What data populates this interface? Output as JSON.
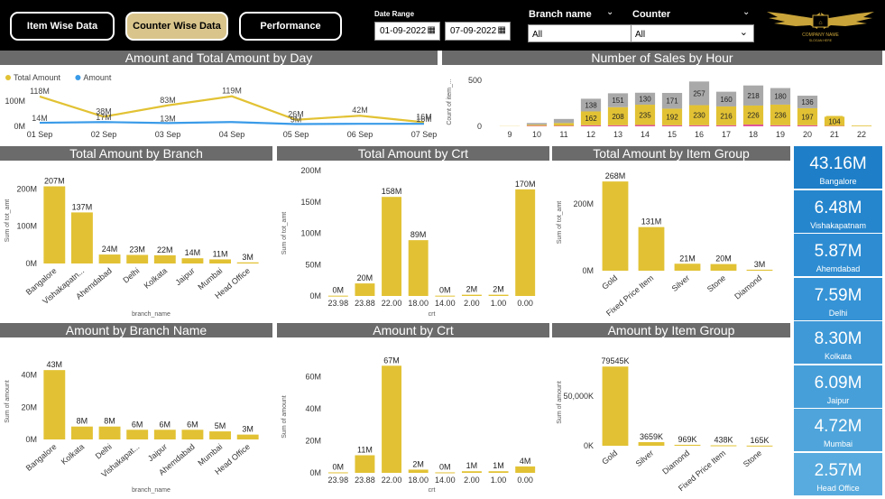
{
  "nav": {
    "item_wise": "Item Wise Data",
    "counter_wise": "Counter Wise Data",
    "performance": "Performance"
  },
  "filters": {
    "date_range_label": "Date Range",
    "date_from": "01-09-2022",
    "date_to": "07-09-2022",
    "branch_label": "Branch name",
    "branch_value": "All",
    "counter_label": "Counter",
    "counter_value": "All"
  },
  "logo": {
    "text": "COMPANY NAME",
    "tagline": "SLOGAN HERE"
  },
  "accent": "#e2c234",
  "cards": [
    {
      "value": "43.16M",
      "name": "Bangalore",
      "color": "#1e7fc8"
    },
    {
      "value": "6.48M",
      "name": "Vishakapatnam",
      "color": "#2686cd"
    },
    {
      "value": "5.87M",
      "name": "Ahemdabad",
      "color": "#2e8dd2"
    },
    {
      "value": "7.59M",
      "name": "Delhi",
      "color": "#3693d5"
    },
    {
      "value": "8.30M",
      "name": "Kolkata",
      "color": "#3f99d7"
    },
    {
      "value": "6.09M",
      "name": "Jaipur",
      "color": "#479fd9"
    },
    {
      "value": "4.72M",
      "name": "Mumbai",
      "color": "#4fa5db"
    },
    {
      "value": "2.57M",
      "name": "Head Office",
      "color": "#58abde"
    }
  ],
  "chart_data": [
    {
      "id": "day",
      "type": "line",
      "title": "Amount and Total Amount by Day",
      "categories": [
        "01 Sep",
        "02 Sep",
        "03 Sep",
        "04 Sep",
        "05 Sep",
        "06 Sep",
        "07 Sep"
      ],
      "series": [
        {
          "name": "Total Amount",
          "color": "#e2c234",
          "values": [
            118,
            38,
            83,
            119,
            26,
            42,
            16
          ],
          "labels": [
            "118M",
            "38M",
            "83M",
            "119M",
            "26M",
            "42M",
            "16M"
          ]
        },
        {
          "name": "Amount",
          "color": "#3a9be8",
          "values": [
            14,
            17,
            13,
            17,
            9,
            10,
            10
          ],
          "labels": [
            "14M",
            "17M",
            "13M",
            "",
            "9M",
            "",
            "16M"
          ]
        }
      ],
      "ylim": [
        0,
        150
      ],
      "yticks": [
        {
          "v": 0,
          "l": "0M"
        },
        {
          "v": 100,
          "l": "100M"
        }
      ],
      "legend": "top-left"
    },
    {
      "id": "hour",
      "type": "bar",
      "stacked": true,
      "title": "Number of Sales by Hour",
      "ylabel": "Count of item_...",
      "categories": [
        "9",
        "10",
        "11",
        "12",
        "13",
        "14",
        "15",
        "16",
        "17",
        "18",
        "19",
        "20",
        "21",
        "22"
      ],
      "series": [
        {
          "name": "pink",
          "color": "#e0559a",
          "values": [
            0,
            6,
            6,
            12,
            12,
            15,
            12,
            12,
            12,
            20,
            12,
            12,
            4,
            0
          ]
        },
        {
          "name": "yellow",
          "color": "#e2c234",
          "values": [
            2,
            12,
            30,
            150,
            196,
            220,
            180,
            218,
            204,
            206,
            224,
            185,
            100,
            8
          ],
          "labels": [
            "",
            "",
            "",
            "162",
            "208",
            "235",
            "192",
            "230",
            "216",
            "226",
            "236",
            "197",
            "104",
            ""
          ]
        },
        {
          "name": "gray",
          "color": "#a9a9a9",
          "values": [
            0,
            18,
            44,
            138,
            151,
            130,
            171,
            257,
            160,
            218,
            180,
            136,
            0,
            0
          ],
          "labels": [
            "",
            "",
            "",
            "138",
            "151",
            "130",
            "171",
            "257",
            "160",
            "218",
            "180",
            "136",
            "",
            ""
          ]
        }
      ],
      "ylim": [
        0,
        500
      ],
      "yticks": [
        {
          "v": 0,
          "l": "0"
        },
        {
          "v": 500,
          "l": "500"
        }
      ]
    },
    {
      "id": "branch",
      "type": "bar",
      "title": "Total Amount by Branch",
      "xlabel": "branch_name",
      "ylabel": "Sum of tot_amt",
      "categories": [
        "Bangalore",
        "Vishakapatn...",
        "Ahemdabad",
        "Delhi",
        "Kolkata",
        "Jaipur",
        "Mumbai",
        "Head Office"
      ],
      "values": [
        207,
        137,
        24,
        23,
        22,
        14,
        11,
        3
      ],
      "labels": [
        "207M",
        "137M",
        "24M",
        "23M",
        "22M",
        "14M",
        "11M",
        "3M"
      ],
      "ylim": [
        0,
        230
      ],
      "yticks": [
        {
          "v": 0,
          "l": "0M"
        },
        {
          "v": 100,
          "l": "100M"
        },
        {
          "v": 200,
          "l": "200M"
        }
      ]
    },
    {
      "id": "crt",
      "type": "bar",
      "title": "Total Amount by Crt",
      "xlabel": "crt",
      "ylabel": "Sum of tot_amt",
      "categories": [
        "23.98",
        "23.88",
        "22.00",
        "18.00",
        "14.00",
        "2.00",
        "1.00",
        "0.00"
      ],
      "values": [
        0.5,
        20,
        158,
        89,
        0.5,
        2,
        2,
        170
      ],
      "labels": [
        "0M",
        "20M",
        "158M",
        "89M",
        "0M",
        "2M",
        "2M",
        "170M"
      ],
      "ylim": [
        0,
        200
      ],
      "yticks": [
        {
          "v": 0,
          "l": "0M"
        },
        {
          "v": 50,
          "l": "50M"
        },
        {
          "v": 100,
          "l": "100M"
        },
        {
          "v": 150,
          "l": "150M"
        },
        {
          "v": 200,
          "l": "200M"
        }
      ]
    },
    {
      "id": "item",
      "type": "bar",
      "title": "Total Amount by Item Group",
      "ylabel": "Sum of tot_amt",
      "categories": [
        "Gold",
        "Fixed Price Item",
        "Silver",
        "Stone",
        "Diamond"
      ],
      "values": [
        268,
        131,
        21,
        20,
        3
      ],
      "labels": [
        "268M",
        "131M",
        "21M",
        "20M",
        "3M"
      ],
      "ylim": [
        0,
        290
      ],
      "yticks": [
        {
          "v": 0,
          "l": "0M"
        },
        {
          "v": 200,
          "l": "200M"
        }
      ]
    },
    {
      "id": "branch2",
      "type": "bar",
      "title": "Amount by Branch Name",
      "xlabel": "branch_name",
      "ylabel": "Sum of amount",
      "categories": [
        "Bangalore",
        "Kolkata",
        "Delhi",
        "Vishakapat...",
        "Jaipur",
        "Ahemdabad",
        "Mumbai",
        "Head Office"
      ],
      "values": [
        43,
        8,
        8,
        6,
        6,
        6,
        5,
        3
      ],
      "labels": [
        "43M",
        "8M",
        "8M",
        "6M",
        "6M",
        "6M",
        "5M",
        "3M"
      ],
      "ylim": [
        0,
        47
      ],
      "yticks": [
        {
          "v": 0,
          "l": "0M"
        },
        {
          "v": 20,
          "l": "20M"
        },
        {
          "v": 40,
          "l": "40M"
        }
      ]
    },
    {
      "id": "crt2",
      "type": "bar",
      "title": "Amount by Crt",
      "xlabel": "crt",
      "ylabel": "Sum of amount",
      "categories": [
        "23.98",
        "23.88",
        "22.00",
        "18.00",
        "14.00",
        "2.00",
        "1.00",
        "0.00"
      ],
      "values": [
        0.3,
        11,
        67,
        2,
        0.3,
        1,
        1,
        4
      ],
      "labels": [
        "0M",
        "11M",
        "67M",
        "2M",
        "0M",
        "1M",
        "1M",
        "4M"
      ],
      "ylim": [
        0,
        70
      ],
      "yticks": [
        {
          "v": 0,
          "l": "0M"
        },
        {
          "v": 20,
          "l": "20M"
        },
        {
          "v": 40,
          "l": "40M"
        },
        {
          "v": 60,
          "l": "60M"
        }
      ]
    },
    {
      "id": "item2",
      "type": "bar",
      "title": "Amount by Item Group",
      "ylabel": "Sum of amount",
      "categories": [
        "Gold",
        "Silver",
        "Diamond",
        "Fixed Price Item",
        "Stone"
      ],
      "values": [
        79545,
        3659,
        969,
        438,
        165
      ],
      "labels": [
        "79545K",
        "3659K",
        "969K",
        "438K",
        "165K"
      ],
      "ylim": [
        0,
        87000
      ],
      "yticks": [
        {
          "v": 0,
          "l": "0K"
        },
        {
          "v": 50000,
          "l": "50,000K"
        }
      ]
    }
  ]
}
